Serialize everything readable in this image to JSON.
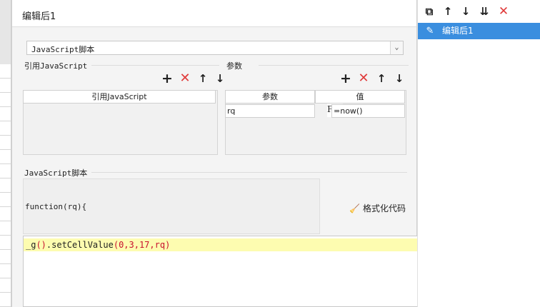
{
  "dialog": {
    "title": "编辑后1",
    "script_type": "JavaScript脚本",
    "ref_group_label": "引用JavaScript",
    "param_group_label": "参数",
    "ref_table": {
      "header": "引用JavaScript"
    },
    "param_table": {
      "headers": [
        "参数",
        "值"
      ],
      "rows": [
        {
          "param": "rq",
          "value": "=now()"
        }
      ]
    },
    "script_group_label": "JavaScript脚本",
    "function_signature": "function(rq){",
    "format_button": "格式化代码",
    "code": {
      "prefix": "_g",
      "call": ".setCellValue",
      "args": "0,3,17,rq"
    }
  },
  "right_panel": {
    "items": [
      {
        "label": "编辑后1",
        "selected": true
      }
    ]
  },
  "colors": {
    "accent": "#3a8edf",
    "delete": "#e03a3a",
    "highlight": "#fdfcb0"
  }
}
